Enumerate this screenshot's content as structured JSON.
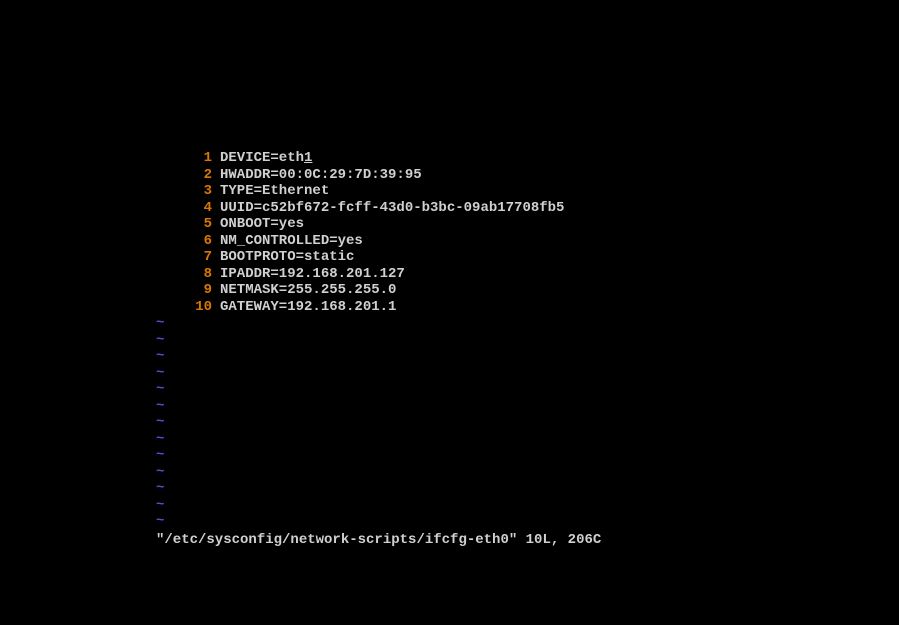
{
  "lines": [
    {
      "n": "1",
      "text": "DEVICE=eth1",
      "underline_last": true
    },
    {
      "n": "2",
      "text": "HWADDR=00:0C:29:7D:39:95"
    },
    {
      "n": "3",
      "text": "TYPE=Ethernet"
    },
    {
      "n": "4",
      "text": "UUID=c52bf672-fcff-43d0-b3bc-09ab17708fb5"
    },
    {
      "n": "5",
      "text": "ONBOOT=yes"
    },
    {
      "n": "6",
      "text": "NM_CONTROLLED=yes"
    },
    {
      "n": "7",
      "text": "BOOTPROTO=static"
    },
    {
      "n": "8",
      "text": "IPADDR=192.168.201.127"
    },
    {
      "n": "9",
      "text": "NETMASK=255.255.255.0"
    },
    {
      "n": "10",
      "text": "GATEWAY=192.168.201.1"
    }
  ],
  "tilde_count": 13,
  "status": "\"/etc/sysconfig/network-scripts/ifcfg-eth0\" 10L, 206C"
}
